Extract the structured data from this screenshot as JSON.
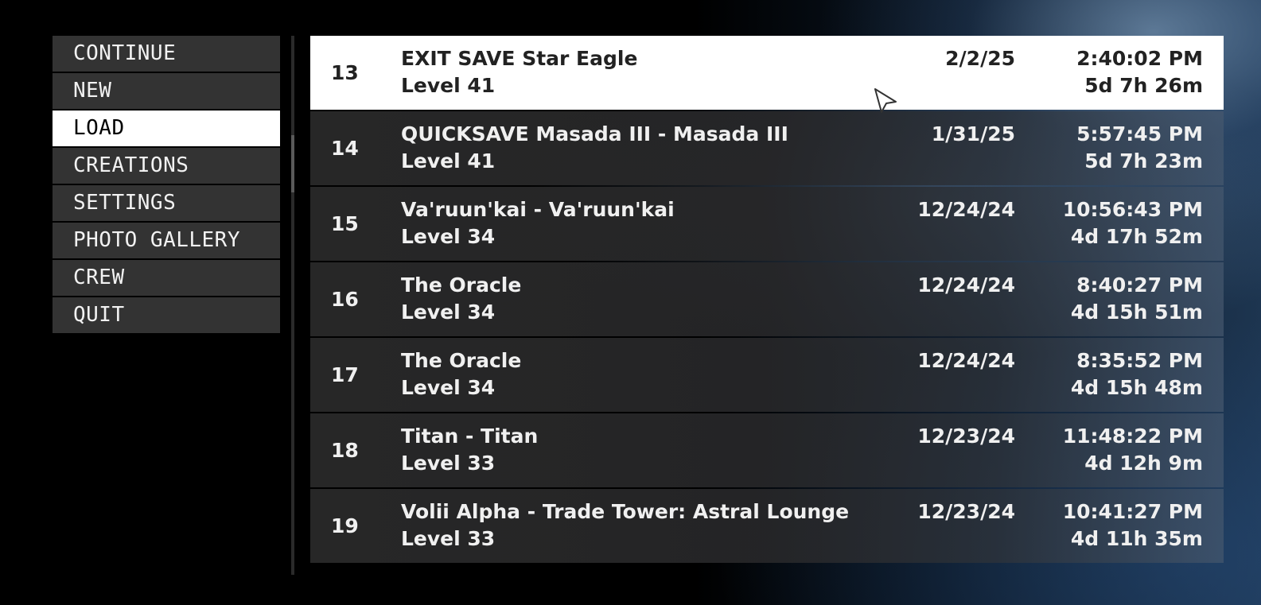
{
  "menu": {
    "items": [
      {
        "label": "CONTINUE",
        "selected": false
      },
      {
        "label": "NEW",
        "selected": false
      },
      {
        "label": "LOAD",
        "selected": true
      },
      {
        "label": "CREATIONS",
        "selected": false
      },
      {
        "label": "SETTINGS",
        "selected": false
      },
      {
        "label": "PHOTO GALLERY",
        "selected": false
      },
      {
        "label": "CREW",
        "selected": false
      },
      {
        "label": "QUIT",
        "selected": false
      }
    ]
  },
  "saves": [
    {
      "number": "13",
      "name": "EXIT SAVE Star Eagle",
      "level": "Level 41",
      "date": "2/2/25",
      "time": "2:40:02 PM",
      "playtime": "5d 7h 26m",
      "selected": true
    },
    {
      "number": "14",
      "name": "QUICKSAVE Masada III - Masada III",
      "level": "Level 41",
      "date": "1/31/25",
      "time": "5:57:45 PM",
      "playtime": "5d 7h 23m",
      "selected": false
    },
    {
      "number": "15",
      "name": "Va'ruun'kai - Va'ruun'kai",
      "level": "Level 34",
      "date": "12/24/24",
      "time": "10:56:43 PM",
      "playtime": "4d 17h 52m",
      "selected": false
    },
    {
      "number": "16",
      "name": "The Oracle",
      "level": "Level 34",
      "date": "12/24/24",
      "time": "8:40:27 PM",
      "playtime": "4d 15h 51m",
      "selected": false
    },
    {
      "number": "17",
      "name": "The Oracle",
      "level": "Level 34",
      "date": "12/24/24",
      "time": "8:35:52 PM",
      "playtime": "4d 15h 48m",
      "selected": false
    },
    {
      "number": "18",
      "name": "Titan - Titan",
      "level": "Level 33",
      "date": "12/23/24",
      "time": "11:48:22 PM",
      "playtime": "4d 12h 9m",
      "selected": false
    },
    {
      "number": "19",
      "name": "Volii Alpha - Trade Tower: Astral Lounge",
      "level": "Level 33",
      "date": "12/23/24",
      "time": "10:41:27 PM",
      "playtime": "4d 11h 35m",
      "selected": false
    }
  ],
  "colors": {
    "panel": "#333333",
    "selected_bg": "#ffffff",
    "text": "#f0f0f0",
    "selected_text": "#222222"
  },
  "icons": {
    "cursor": "mouse-pointer-icon"
  }
}
